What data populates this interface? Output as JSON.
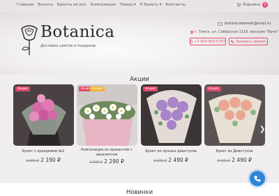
{
  "topbar": {
    "nav": [
      "Главная",
      "Букеты",
      "Букеты из роз",
      "Композиции",
      "Повод",
      "К букету",
      "Контакты"
    ],
    "nav_dropdown": [
      false,
      false,
      false,
      false,
      true,
      true,
      false
    ],
    "basket_label": "Корзина",
    "basket_count": "0"
  },
  "brand": {
    "name": "Botanica",
    "tagline": "Доставка цветов и подарков"
  },
  "contacts": {
    "email": "botanicatomsk@mail.ru",
    "address": "г. Томск, ул. Сибирская 111б, магазин \"Ярче\"",
    "phone": "+7-933-833-5757",
    "call_label": "Заказать звонок"
  },
  "sections": {
    "sale_title": "Акции",
    "new_title": "Новинки"
  },
  "products": [
    {
      "name": "Букет с орхидеями №2",
      "old_price": "2 850 ₽",
      "price": "2 190 ₽",
      "badges": [
        "Акция"
      ]
    },
    {
      "name": "Композиция из хризантем с эвкалиптом",
      "old_price": "2 590 ₽",
      "price": "2 290 ₽",
      "badges": [
        "Акция",
        "Новый"
      ]
    },
    {
      "name": "Букет из лунных диантусов",
      "old_price": "3 300 ₽",
      "price": "2 490 ₽",
      "badges": [
        "Акция"
      ]
    },
    {
      "name": "Букет из Диантусов",
      "old_price": "3 500 ₽",
      "price": "2 490 ₽",
      "badges": [
        "Акция"
      ]
    }
  ],
  "colors": {
    "accent": "#e04a6f",
    "badge_new": "#f3b432",
    "call_button": "#2f86d8"
  }
}
